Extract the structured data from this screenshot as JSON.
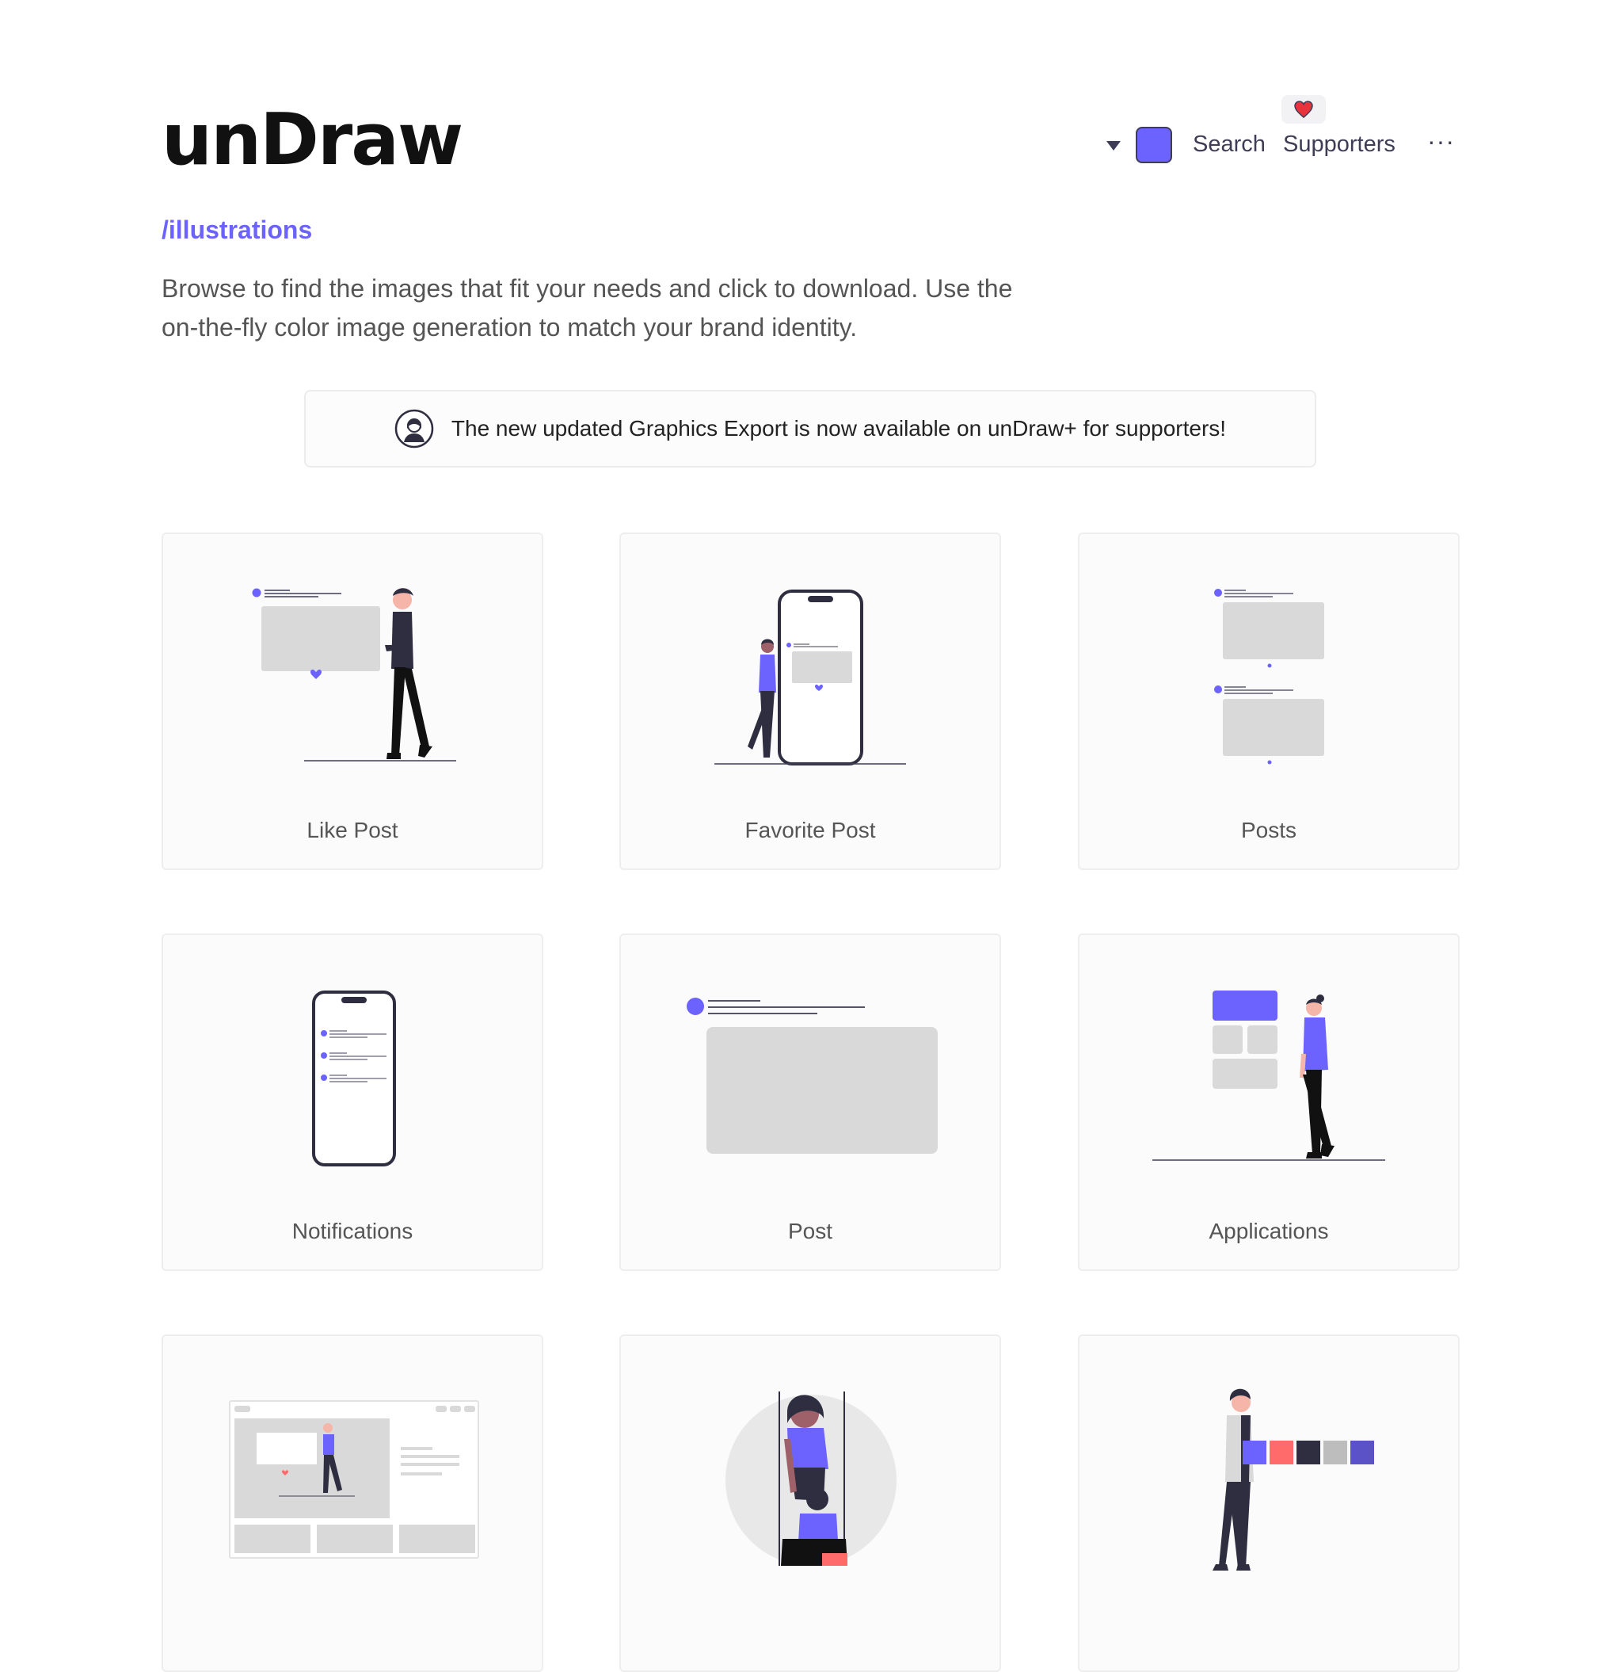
{
  "header": {
    "logo": "unDraw",
    "subtitle": "/illustrations",
    "description": "Browse to find the images that fit your needs and click to download. Use the on-the-fly color image generation to match your brand identity."
  },
  "nav": {
    "dropdown_icon": "caret-down-icon",
    "color_swatch": "#6c63ff",
    "search_label": "Search",
    "supporters_label": "Supporters",
    "supporters_icon": "heart-icon",
    "more_label": "···"
  },
  "banner": {
    "icon": "avatar-icon",
    "text": "The new updated Graphics Export is now available on unDraw+ for supporters!"
  },
  "colors": {
    "accent": "#6c63ff",
    "dark": "#2f2e41",
    "placeholder": "#d9d9d9",
    "heart": "#e8323c"
  },
  "illustrations": [
    {
      "label": "Like Post"
    },
    {
      "label": "Favorite Post"
    },
    {
      "label": "Posts"
    },
    {
      "label": "Notifications"
    },
    {
      "label": "Post"
    },
    {
      "label": "Applications"
    },
    {
      "label": ""
    },
    {
      "label": ""
    },
    {
      "label": ""
    }
  ]
}
